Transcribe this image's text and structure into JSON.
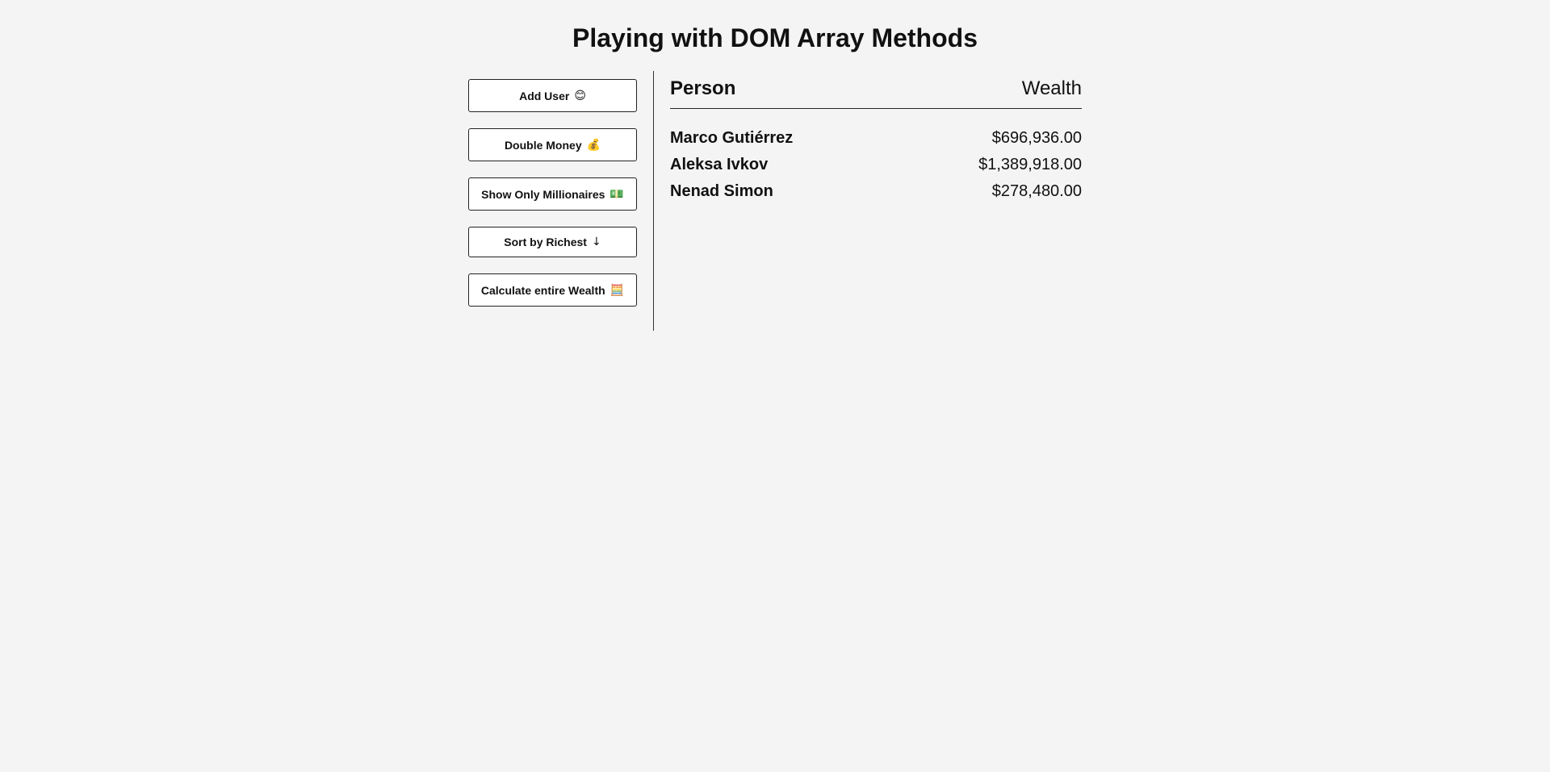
{
  "page": {
    "title": "Playing with DOM Array Methods"
  },
  "sidebar": {
    "buttons": [
      {
        "label": "Add User",
        "icon": "😊",
        "icon_name": "smiling-face-icon"
      },
      {
        "label": "Double Money",
        "icon": "💰",
        "icon_name": "money-bag-icon"
      },
      {
        "label": "Show Only Millionaires",
        "icon": "💵",
        "icon_name": "banknote-icon"
      },
      {
        "label": "Sort by Richest",
        "icon": "↓",
        "icon_name": "arrow-down-icon"
      },
      {
        "label": "Calculate entire Wealth",
        "icon": "🧮",
        "icon_name": "abacus-icon"
      }
    ]
  },
  "table": {
    "header_person": "Person",
    "header_wealth": "Wealth",
    "rows": [
      {
        "name": "Marco Gutiérrez",
        "wealth": "$696,936.00"
      },
      {
        "name": "Aleksa Ivkov",
        "wealth": "$1,389,918.00"
      },
      {
        "name": "Nenad Simon",
        "wealth": "$278,480.00"
      }
    ]
  },
  "colors": {
    "background": "#f4f4f4",
    "button_background": "#ffffff",
    "border": "#222222",
    "text": "#111111"
  }
}
